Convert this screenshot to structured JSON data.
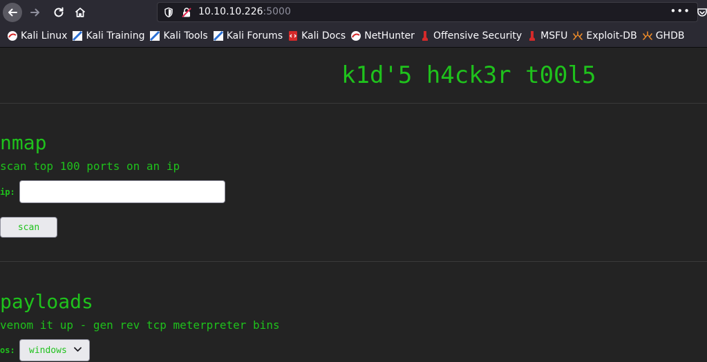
{
  "browser": {
    "url_host": "10.10.10.226",
    "url_port": ":5000",
    "menu_label": "•••",
    "bookmarks": [
      {
        "label": "Kali Linux",
        "icon": "kali-dragon-icon"
      },
      {
        "label": "Kali Training",
        "icon": "kali-training-icon"
      },
      {
        "label": "Kali Tools",
        "icon": "kali-tools-icon"
      },
      {
        "label": "Kali Forums",
        "icon": "kali-forums-icon"
      },
      {
        "label": "Kali Docs",
        "icon": "kali-docs-icon"
      },
      {
        "label": "NetHunter",
        "icon": "nethunter-icon"
      },
      {
        "label": "Offensive Security",
        "icon": "offsec-icon"
      },
      {
        "label": "MSFU",
        "icon": "msfu-icon"
      },
      {
        "label": "Exploit-DB",
        "icon": "exploitdb-icon"
      },
      {
        "label": "GHDB",
        "icon": "ghdb-icon"
      }
    ]
  },
  "page": {
    "title": "k1d'5 h4ck3r t00l5",
    "nmap": {
      "title": "nmap",
      "description": "scan top 100 ports on an ip",
      "ip_label": "ip:",
      "ip_value": "",
      "scan_label": "scan"
    },
    "payloads": {
      "title": "payloads",
      "description": "venom it up - gen rev tcp meterpreter bins",
      "os_label": "os:",
      "os_selected": "windows"
    }
  },
  "colors": {
    "accent_green": "#1fc21c",
    "page_background": "#232323",
    "chrome_background": "#2b2a33"
  }
}
